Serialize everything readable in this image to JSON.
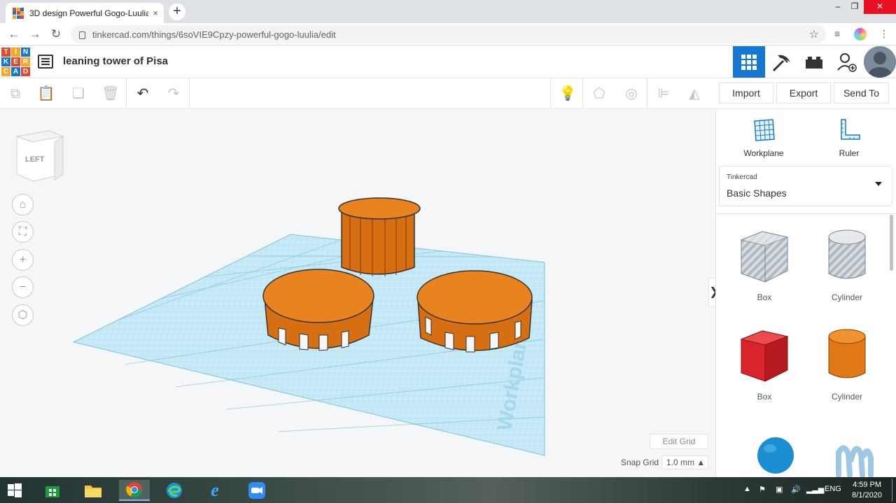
{
  "browser": {
    "tab_title": "3D design Powerful Gogo-Luulia",
    "tab_close": "×",
    "new_tab": "+",
    "url": "tinkercad.com/things/6soVIE9Cpzy-powerful-gogo-luulia/edit",
    "window_controls": {
      "minimize": "–",
      "maximize": "❐",
      "close": "✕"
    }
  },
  "tinkercad": {
    "logo_letters": [
      "T",
      "I",
      "N",
      "K",
      "E",
      "R",
      "C",
      "A",
      "D"
    ],
    "logo_colors": [
      "#e2472f",
      "#f5a623",
      "#1477d1",
      "#e2472f",
      "#f5a623",
      "#1477d1",
      "#e2472f",
      "#f5a623",
      "#1477d1"
    ],
    "design_title": "leaning tower of Pisa",
    "accent": "#1477d1"
  },
  "toolbar": {
    "import_label": "Import",
    "export_label": "Export",
    "send_to_label": "Send To"
  },
  "canvas": {
    "viewcube_label": "LEFT",
    "workplane_watermark": "Workplane",
    "edit_grid_label": "Edit Grid",
    "snap_grid_label": "Snap Grid",
    "snap_grid_value": "1.0 mm ▲",
    "collapse_glyph": "❯"
  },
  "panel": {
    "workplane_label": "Workplane",
    "ruler_label": "Ruler",
    "library_source": "Tinkercad",
    "library_name": "Basic Shapes",
    "shapes": [
      {
        "label": "Box",
        "style": "hole"
      },
      {
        "label": "Cylinder",
        "style": "hole"
      },
      {
        "label": "Box",
        "color": "#d9242b"
      },
      {
        "label": "Cylinder",
        "color": "#e8831f"
      }
    ]
  },
  "taskbar": {
    "lang": "ENG",
    "time": "4:59 PM",
    "date": "8/1/2020"
  }
}
